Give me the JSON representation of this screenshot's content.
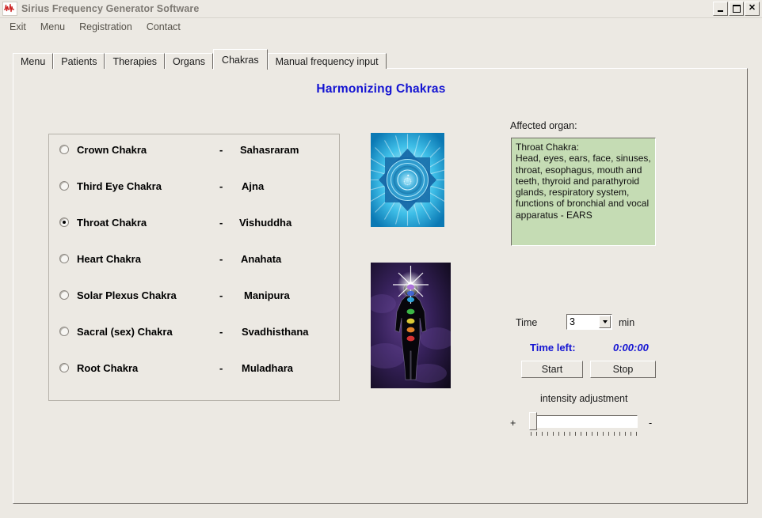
{
  "window": {
    "title": "Sirius Frequency Generator Software",
    "icon": "waveform-icon",
    "controls": {
      "minimize": "minimize-icon",
      "maximize": "maximize-icon",
      "close": "close-icon"
    }
  },
  "menubar": {
    "items": [
      {
        "label": "Exit"
      },
      {
        "label": "Menu"
      },
      {
        "label": "Registration"
      },
      {
        "label": "Contact"
      }
    ]
  },
  "tabs": {
    "active": "Chakras",
    "items": [
      {
        "label": "Menu"
      },
      {
        "label": "Patients"
      },
      {
        "label": "Therapies"
      },
      {
        "label": "Organs"
      },
      {
        "label": "Chakras"
      },
      {
        "label": "Manual frequency input"
      }
    ]
  },
  "main": {
    "page_title": "Harmonizing Chakras",
    "title_color": "#1414d2",
    "chakras": [
      {
        "name": "Crown Chakra",
        "dash": "-",
        "sanskrit": "Sahasraram",
        "selected": false
      },
      {
        "name": "Third Eye Chakra",
        "dash": "-",
        "sanskrit": "Ajna",
        "selected": false
      },
      {
        "name": "Throat Chakra",
        "dash": "-",
        "sanskrit": "Vishuddha",
        "selected": true
      },
      {
        "name": "Heart Chakra",
        "dash": "-",
        "sanskrit": "Anahata",
        "selected": false
      },
      {
        "name": "Solar Plexus Chakra",
        "dash": "-",
        "sanskrit": "Manipura",
        "selected": false
      },
      {
        "name": "Sacral (sex) Chakra",
        "dash": "-",
        "sanskrit": "Svadhisthana",
        "selected": false
      },
      {
        "name": "Root Chakra",
        "dash": "-",
        "sanskrit": "Muladhara",
        "selected": false
      }
    ],
    "images": {
      "chakra_symbol": "vishuddha-throat-chakra-symbol",
      "body_chakra_map": "human-body-chakra-points-image"
    },
    "affected_organ": {
      "label": "Affected organ:",
      "text": "Throat Chakra:\nHead, eyes, ears, face, sinuses, throat, esophagus, mouth and teeth, thyroid and parathyroid glands, respiratory system, functions of bronchial and vocal apparatus - EARS",
      "background_color": "#c5dcb4"
    },
    "timer": {
      "time_label": "Time",
      "time_value": "3",
      "unit_label": "min",
      "time_left_label": "Time left:",
      "time_left_value": "0:00:00",
      "time_left_color": "#1414d2",
      "start_label": "Start",
      "stop_label": "Stop"
    },
    "intensity": {
      "label": "intensity adjustment",
      "plus": "+",
      "minus": "-",
      "value_percent": 0
    }
  }
}
